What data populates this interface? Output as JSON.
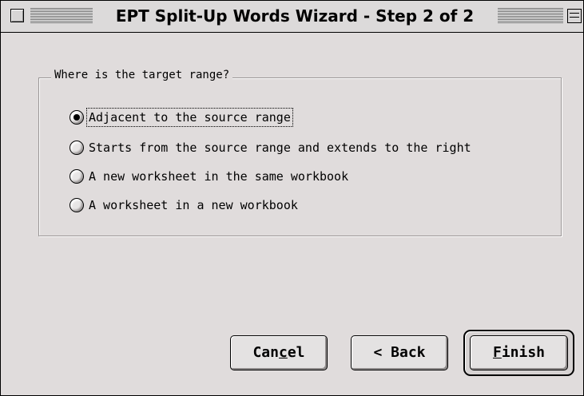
{
  "window": {
    "title": "EPT Split-Up Words Wizard - Step 2 of 2"
  },
  "group": {
    "label": "Where is the target range?",
    "options": [
      {
        "label": "Adjacent to the source range",
        "selected": true
      },
      {
        "label": "Starts from the source range and extends to the right",
        "selected": false
      },
      {
        "label": "A new worksheet in the same workbook",
        "selected": false
      },
      {
        "label": "A worksheet in a new workbook",
        "selected": false
      }
    ]
  },
  "buttons": {
    "cancel": {
      "before": "Can",
      "mnemonic": "c",
      "after": "el"
    },
    "back": {
      "label": "< Back"
    },
    "finish": {
      "before": "",
      "mnemonic": "F",
      "after": "inish"
    }
  },
  "icons": {
    "close_box": "close-box-icon",
    "zoom_box": "zoom-box-icon",
    "radio": "radio-button-icon"
  }
}
